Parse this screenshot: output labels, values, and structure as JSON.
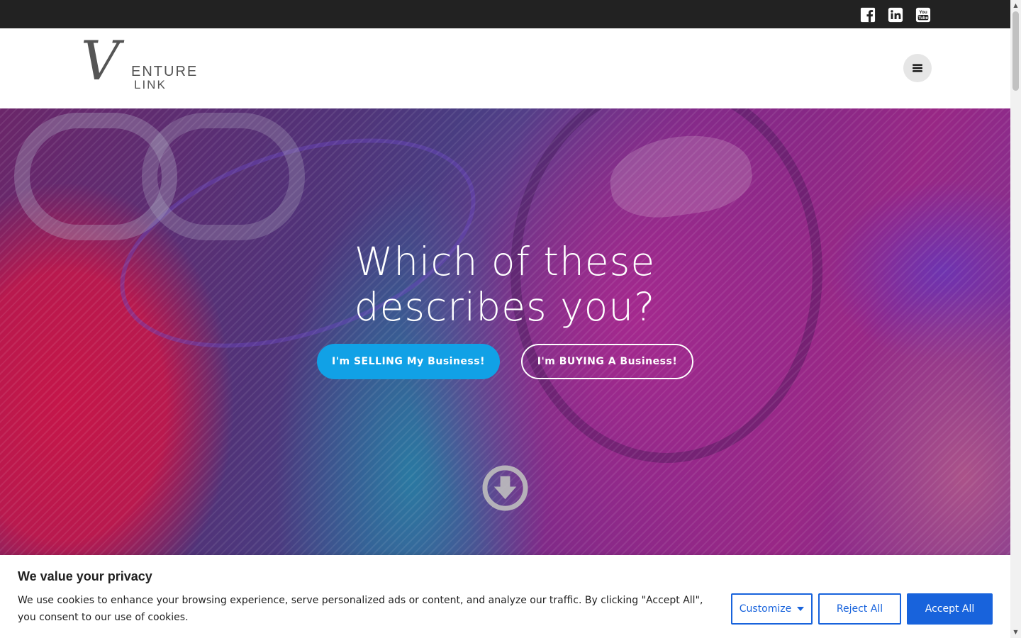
{
  "social": {
    "facebook": "facebook-icon",
    "linkedin": "linkedin-icon",
    "youtube": "youtube-icon"
  },
  "logo": {
    "letter": "V",
    "line1": "ENTURE",
    "line2": "LINK"
  },
  "header": {
    "menu_icon": "hamburger-icon"
  },
  "hero": {
    "title": "Which of these describes you?",
    "sell_button": "I'm SELLING My Business!",
    "buy_button": "I'm BUYING A Business!",
    "scroll_icon": "arrow-down-circle-icon"
  },
  "cookie": {
    "title": "We value your privacy",
    "text": "We use cookies to enhance your browsing experience, serve personalized ads or content, and analyze our traffic. By clicking \"Accept All\", you consent to our use of cookies.",
    "customize": "Customize",
    "reject": "Reject All",
    "accept": "Accept All"
  },
  "colors": {
    "topbar": "#222222",
    "primary_button": "#11a1e6",
    "cookie_accent": "#1863dc"
  }
}
